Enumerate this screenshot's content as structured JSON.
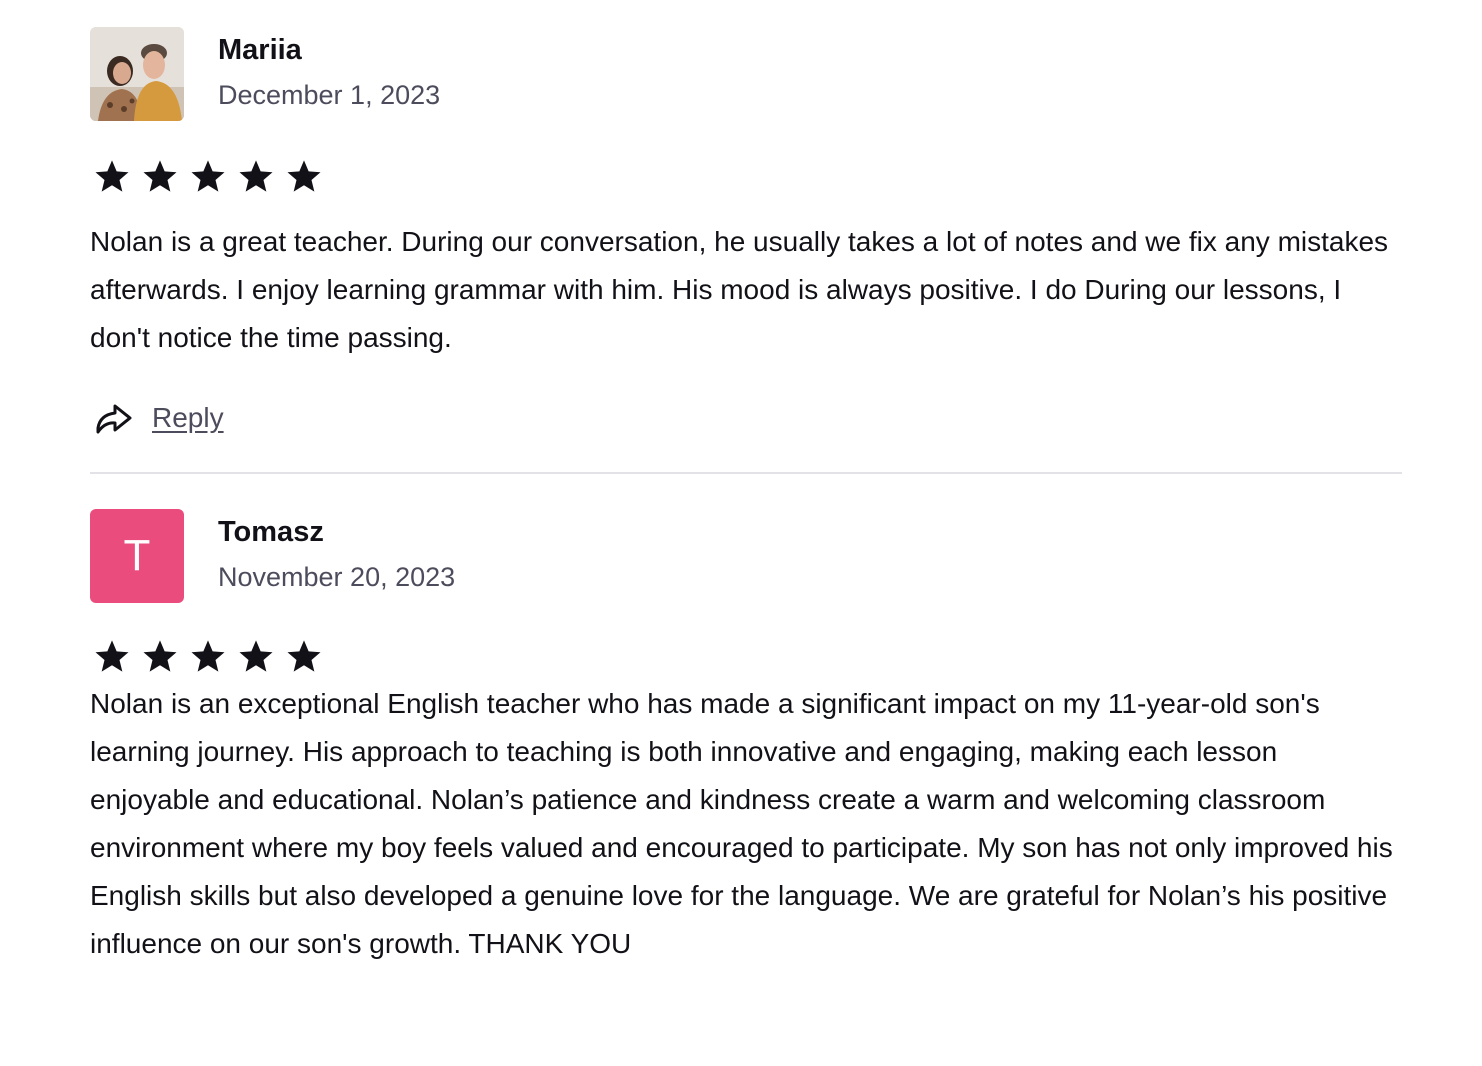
{
  "reviews": [
    {
      "name": "Mariia",
      "date": "December 1, 2023",
      "rating": 5,
      "avatar": {
        "type": "photo"
      },
      "text": "Nolan is a great teacher. During our conversation, he usually takes a lot of notes and we fix any mistakes afterwards. I enjoy learning grammar with him. His mood is always positive. I do During our lessons, I don't notice the time passing.",
      "reply_label": "Reply"
    },
    {
      "name": "Tomasz",
      "date": "November 20, 2023",
      "rating": 5,
      "avatar": {
        "type": "initial",
        "letter": "T",
        "color": "#ea4c7e"
      },
      "text": "Nolan is an exceptional English teacher who has made a significant impact on my 11-year-old son's learning journey. His approach to teaching is both innovative and engaging, making each lesson enjoyable and educational. Nolan’s patience and kindness create a warm and welcoming classroom environment where my boy feels valued and encouraged to participate. My son has not only improved his English skills but also developed a genuine love for the language. We are grateful for Nolan’s his positive influence on our son's growth. THANK YOU"
    }
  ],
  "icons": {
    "star": "star-icon",
    "reply": "share-arrow-icon"
  },
  "colors": {
    "text": "#121117",
    "muted": "#4d4c5c",
    "divider": "#e3e3e7",
    "star": "#121117"
  }
}
